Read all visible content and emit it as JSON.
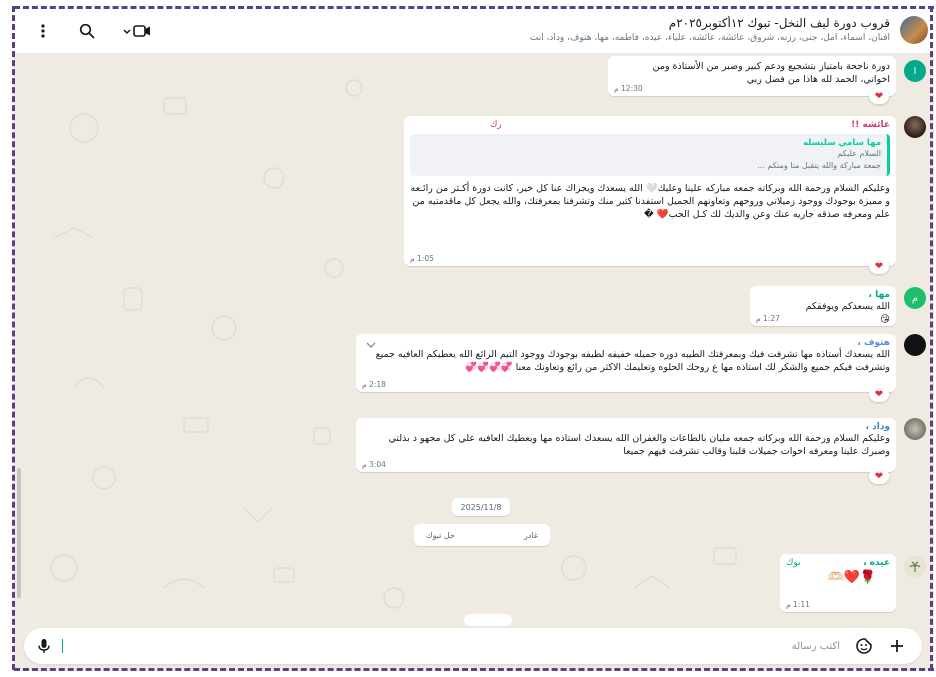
{
  "header": {
    "title": "قروب دورة ليف النخل- تبوك ١٢أكتوبر٢٠٢٥م",
    "members": "أفنان، أسماء، امل، جنى، رزنه، شروق، عائشة، عائشه، علياء، عيده، فاطمه، مها، هتوف، وداد، أنت"
  },
  "composer": {
    "placeholder": "اكتب رسالة"
  },
  "messages": {
    "m1": {
      "avatar": "I",
      "text": "دورة ناجحة بامتياز بتشجيع ودعم كبير وصبر من الأستاذة ومن اخواتي، الحمد لله هاذا من فضل ربي",
      "time": "12:30 م",
      "reaction": "❤"
    },
    "m2": {
      "sender": "عائشه !!",
      "sender_tag": "رك",
      "quote_name": "مها سامي سليسله",
      "quote_line1": "السلام عليكم",
      "quote_line2": "جمعة مباركة والله يتقبل منا ومنكم ...",
      "text": "وعليكم السلام ورحمة الله وبركاته جمعه مباركه علينا وعليك🤍 الله يسعدك ويجزاك عنا كل خير، كانت دورة أكـثر من رائـعه و مميزة بوجودك ووجود زميلاتي وروحهم وتعاونهم الجميل استفدنا كثير منك وتشرفنا بمعرفتك، والله يجعل كل ماقدمتيه من علم ومعرفه صدقه جاريه عنك وعن والديك لك كـل الحب❤️ �",
      "time": "1:05 م",
      "reaction": "❤"
    },
    "m3": {
      "avatar": "م",
      "sender": "مها ،",
      "text": "الله يسعدكم ويوفقكم 😘",
      "time": "1:27 م",
      "reaction": "❤"
    },
    "m4": {
      "sender": "هتوف ،",
      "text": "الله يسعدك أستاذه مها تشرفت فيك وبمعرفتك الطيبه دوره جميله خفيفه لطيفه بوجودك ووجود التيم الرائع الله يعطيكم العافيه جميع وتشرفت فيكم جميع والشكر لك استاذه مها ع روحك الحلوه وتعليمك الاكثر من رائع وتعاونك معنا 💞💞💞💞",
      "time": "2:18 م",
      "reaction": "❤"
    },
    "m5": {
      "sender": "وداد ،",
      "text": "وعليكم السلام ورحمة الله وبركاته جمعه مليان بالطاعات والغفران الله يسعدك استاذه مها ويعطيك العافيه علي كل مجهو د بذلتي وصبرك علينا ومعرفه اخوات جميلات قلبنا وقالب تشرفت فيهم جميعا",
      "time": "3:04 م",
      "reaction": "❤"
    },
    "m6": {
      "sender": "عيده ،",
      "sender_tag": "بوك",
      "text": "🌹❤️🫶🏻",
      "time": "1:11 م"
    }
  },
  "date_separator": "2025/11/8",
  "system_pill": {
    "right": "غادر",
    "left": "حل تبوك"
  },
  "icons": {
    "menu": "kebab-icon",
    "search": "search-icon",
    "video": "video-icon",
    "mic": "mic-icon",
    "emoji": "sticker-icon",
    "plus": "plus-icon"
  },
  "colors": {
    "accent": "#00a884",
    "chat_bg": "#efeae2",
    "frame_dash": "#5a3f86"
  }
}
